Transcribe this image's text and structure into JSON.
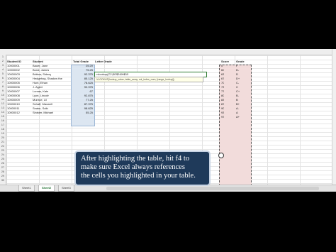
{
  "table": {
    "headers": [
      "Student ID",
      "Student",
      "Total Grade",
      "Letter Grade"
    ],
    "rows": [
      [
        "10000001",
        "Bauer, Jane",
        "25.20"
      ],
      [
        "10000002",
        "Bond, James",
        "75.25"
      ],
      [
        "10000003",
        "Brittow, Sidney",
        "92.375"
      ],
      [
        "10000004",
        "Hedgehog, Shadow the",
        "85.125"
      ],
      [
        "10000005",
        "Hunt, Ethan",
        "78.625"
      ],
      [
        "10000006",
        "J. Agent",
        "92.375"
      ],
      [
        "10000007",
        "Lomas, Kate",
        "67"
      ],
      [
        "10000008",
        "Lyon, Lincoln",
        "92.875"
      ],
      [
        "10000009",
        "Munroe, Lil",
        "77.25"
      ],
      [
        "10000010",
        "Schaff, Maxwell",
        "87.375"
      ],
      [
        "10000011",
        "Snake, Solid",
        "98.625"
      ],
      [
        "10000012",
        "Sinister, Michael",
        "55.25"
      ]
    ]
  },
  "formula": {
    "cell_text": "=vlookup(C2,$G$3:$H$15",
    "tooltip": "VLOOKUP(lookup_value, table_array, col_index_num, [range_lookup])"
  },
  "lookup": {
    "headers": [
      "Score",
      "Grade"
    ],
    "rows": [
      [
        "0",
        "F"
      ],
      [
        "60",
        "D-"
      ],
      [
        "63",
        "D"
      ],
      [
        "67",
        "D+"
      ],
      [
        "70",
        "C-"
      ],
      [
        "73",
        "C"
      ],
      [
        "77",
        "C+"
      ],
      [
        "80",
        "B-"
      ],
      [
        "83",
        "B"
      ],
      [
        "87",
        "B+"
      ],
      [
        "90",
        "A-"
      ],
      [
        "93",
        "A"
      ],
      [
        "97",
        "A+"
      ]
    ]
  },
  "row_numbers": [
    "1",
    "2",
    "3",
    "4",
    "5",
    "6",
    "7",
    "8",
    "9",
    "10",
    "11",
    "12",
    "13",
    "14",
    "15",
    "16",
    "17",
    "18",
    "19",
    "20",
    "21",
    "22",
    "23",
    "24",
    "25",
    "26",
    "27",
    "28",
    "29",
    "30"
  ],
  "sheets": {
    "tabs": [
      "Sheet1",
      "Sheet2",
      "Sheet3"
    ],
    "active": "Sheet2"
  },
  "caption": {
    "line1": "After highlighting the table, hit f4 to",
    "line2": "make sure Excel always references",
    "line3": "the cells you highlighted in your table."
  }
}
